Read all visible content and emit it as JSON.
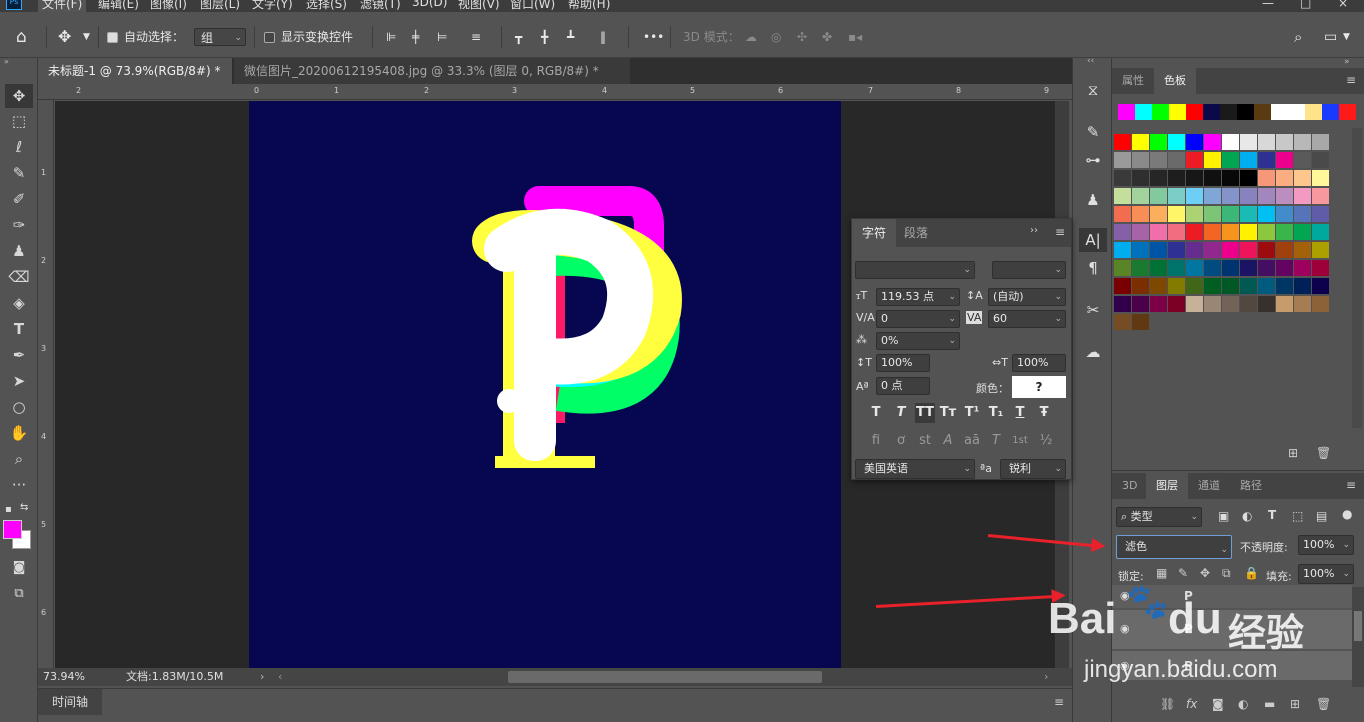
{
  "app": {
    "logo": "Ps"
  },
  "menu": [
    "文件(F)",
    "编辑(E)",
    "图像(I)",
    "图层(L)",
    "文字(Y)",
    "选择(S)",
    "滤镜(T)",
    "3D(D)",
    "视图(V)",
    "窗口(W)",
    "帮助(H)"
  ],
  "options_bar": {
    "auto_select_label": "自动选择：",
    "auto_select_value": "组",
    "show_transform_label": "显示变换控件",
    "mode_3d_label": "3D 模式：",
    "more_label": "•••"
  },
  "tabs": [
    {
      "label": "未标题-1 @ 73.9%(RGB/8#) *"
    },
    {
      "label": "微信图片_20200612195408.jpg @ 33.3% (图层 0, RGB/8#) *"
    }
  ],
  "ruler_top_labels": [
    "2",
    "0",
    "1",
    "2",
    "3",
    "4",
    "5",
    "6",
    "7",
    "8",
    "9"
  ],
  "ruler_left_labels": [
    "1",
    "2",
    "3",
    "4",
    "5",
    "6"
  ],
  "canvas": {
    "letter": "P",
    "background": "#060750",
    "layers": [
      "#ff00ff",
      "#ff1a66",
      "#00ff66",
      "#00ffff",
      "#ffff40",
      "#ffffff"
    ]
  },
  "status": {
    "zoom": "73.94%",
    "doc": "文档:1.83M/10.5M"
  },
  "timeline": {
    "label": "时间轴"
  },
  "character_panel": {
    "tab_char": "字符",
    "tab_para": "段落",
    "font_size": "119.53 点",
    "leading": "(自动)",
    "kerning": "0",
    "tracking": "60",
    "scale_tsume": "0%",
    "vscale": "100%",
    "hscale": "100%",
    "baseline": "0 点",
    "color_label": "颜色：",
    "color_value": "?",
    "language": "美国英语",
    "aa_label": "a",
    "antialias": "锐利",
    "format_buttons": [
      "T",
      "T",
      "TT",
      "Tт",
      "T¹",
      "T₁",
      "T",
      "Ŧ"
    ],
    "opentype_buttons": [
      "fi",
      "ơ",
      "st",
      "A",
      "aā",
      "T",
      "1st",
      "½"
    ]
  },
  "swatches_panel": {
    "tab_props": "属性",
    "tab_swatches": "色板",
    "recent": [
      "#ff00ff",
      "#00ffff",
      "#00ff00",
      "#ffff00",
      "#ff0000",
      "#0a0a4a",
      "#1a1a1a",
      "#000000",
      "#5a3a10",
      "#ffffff",
      "#ffffff",
      "#ffe38a",
      "#1a3aff",
      "#ff1a1a"
    ],
    "grid": [
      [
        "#ff0000",
        "#ffff00",
        "#00ff00",
        "#00ffff",
        "#0000ff",
        "#ff00ff",
        "#ffffff",
        "#e8e8e8",
        "#d8d8d8",
        "#c8c8c8",
        "#b8b8b8",
        "#a8a8a8"
      ],
      [
        "#9a9a9a",
        "#8a8a8a",
        "#7a7a7a",
        "#6a6a6a",
        "#ed1c24",
        "#fff200",
        "#00a651",
        "#00aeef",
        "#2e3192",
        "#ec008c",
        "#5a5a5a",
        "#4a4a4a"
      ],
      [
        "#3a3a3a",
        "#2f2f2f",
        "#262626",
        "#1e1e1e",
        "#171717",
        "#101010",
        "#080808",
        "#000000",
        "#f7977a",
        "#f9ad81",
        "#fdc68a",
        "#fff79a"
      ],
      [
        "#c4df9b",
        "#a3d39c",
        "#82ca9d",
        "#7bcdc8",
        "#6ecff6",
        "#7ea7d8",
        "#8493ca",
        "#8882be",
        "#a187be",
        "#bc8dbf",
        "#f49ac2",
        "#f6989d"
      ],
      [
        "#f26c4f",
        "#f68e56",
        "#fbaf5d",
        "#fff568",
        "#acd373",
        "#7cc576",
        "#3bb878",
        "#1abbb4",
        "#00bff3",
        "#438ccb",
        "#5574b9",
        "#605ca8"
      ],
      [
        "#855fa8",
        "#a763a8",
        "#f06ea9",
        "#f26d7d",
        "#ed1c24",
        "#f26522",
        "#f7941d",
        "#fff200",
        "#8dc63f",
        "#39b54a",
        "#00a651",
        "#00a99d"
      ],
      [
        "#00aeef",
        "#0072bc",
        "#0054a6",
        "#2e3192",
        "#662d91",
        "#92278f",
        "#ec008c",
        "#ed145b",
        "#9e0b0f",
        "#a0410d",
        "#a3620a",
        "#aba000"
      ],
      [
        "#598527",
        "#1a7b30",
        "#007236",
        "#00746b",
        "#0076a3",
        "#004b80",
        "#003471",
        "#1b1464",
        "#440e62",
        "#630460",
        "#9e005d",
        "#9e0039"
      ],
      [
        "#790000",
        "#7b2e00",
        "#7d4900",
        "#827b00",
        "#406618",
        "#005e20",
        "#005826",
        "#005952",
        "#005b7f",
        "#003663",
        "#002157",
        "#0d004c"
      ],
      [
        "#32004b",
        "#4b0049",
        "#7b0046",
        "#7a0026",
        "#c7b299",
        "#998675",
        "#736357",
        "#534741",
        "#37302d",
        "#c69c6d",
        "#a67c52",
        "#8c6239"
      ],
      [
        "#754c24",
        "#603913"
      ]
    ]
  },
  "layers_panel": {
    "tabs": [
      "3D",
      "图层",
      "通道",
      "路径"
    ],
    "filter_label": "类型",
    "blend_mode": "滤色",
    "opacity_label": "不透明度:",
    "opacity_value": "100%",
    "lock_label": "锁定:",
    "fill_label": "填充:",
    "fill_value": "100%",
    "layer_names": [
      "P",
      "P",
      "P"
    ]
  },
  "watermark": {
    "brand_a": "Bai",
    "brand_b": "du",
    "brand_cn": "经验",
    "url": "jingyan.baidu.com"
  }
}
